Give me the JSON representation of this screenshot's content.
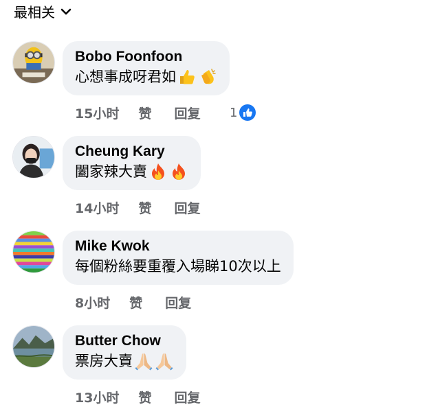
{
  "sort": {
    "label": "最相关"
  },
  "comments": [
    {
      "author": "Bobo Foonfoon",
      "text": "心想事成呀君如",
      "emojis": [
        "thumbs-up",
        "clapping-hands"
      ],
      "time": "15小时",
      "like_label": "赞",
      "reply_label": "回复",
      "reaction_count": "1"
    },
    {
      "author": "Cheung Kary",
      "text": "闔家辣大賣",
      "emojis": [
        "fire",
        "fire"
      ],
      "time": "14小时",
      "like_label": "赞",
      "reply_label": "回复"
    },
    {
      "author": "Mike Kwok",
      "text": "每個粉絲要重覆入場睇10次以上",
      "emojis": [],
      "time": "8小时",
      "like_label": "赞",
      "reply_label": "回复"
    },
    {
      "author": "Butter Chow",
      "text": "票房大賣",
      "emojis": [
        "folded-hands",
        "folded-hands"
      ],
      "time": "13小时",
      "like_label": "赞",
      "reply_label": "回复"
    }
  ]
}
